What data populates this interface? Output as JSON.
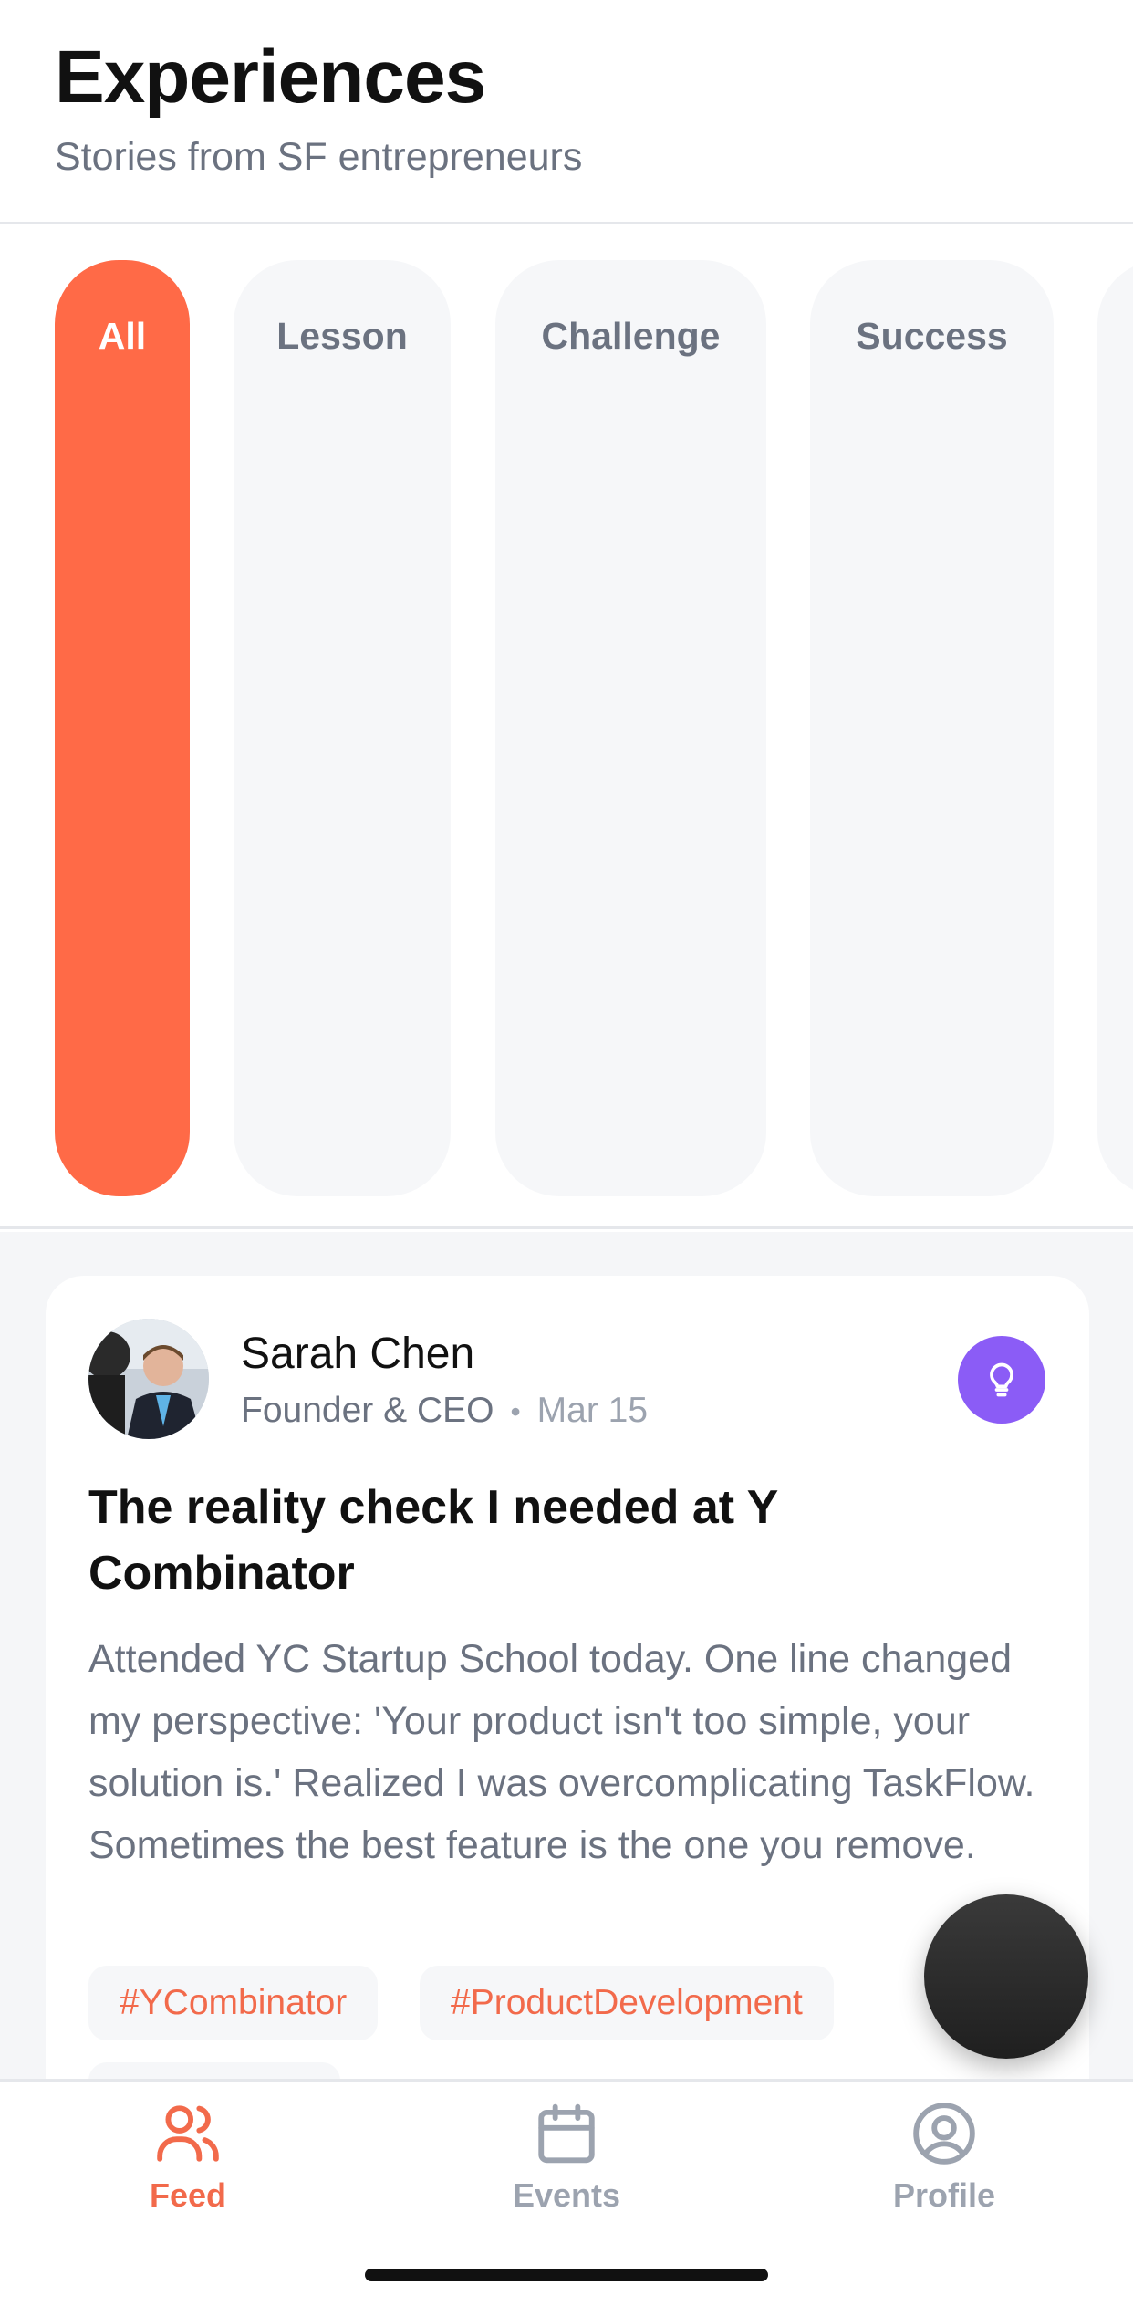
{
  "header": {
    "title": "Experiences",
    "subtitle": "Stories from SF entrepreneurs"
  },
  "filters": [
    {
      "label": "All",
      "active": true
    },
    {
      "label": "Lesson",
      "active": false
    },
    {
      "label": "Challenge",
      "active": false
    },
    {
      "label": "Success",
      "active": false
    }
  ],
  "post": {
    "author": "Sarah Chen",
    "role": "Founder & CEO",
    "date": "Mar 15",
    "type_icon": "lightbulb-icon",
    "title": "The reality check I needed at Y Combinator",
    "body": "Attended YC Startup School today. One line changed my perspective: 'Your product isn't too simple, your solution is.' Realized I was overcomplicating TaskFlow. Sometimes the best feature is the one you remove.",
    "tags": [
      "#YCombinator",
      "#ProductDevelopment"
    ]
  },
  "fab": {
    "icon": "compose-icon"
  },
  "tabs": [
    {
      "label": "Feed",
      "icon": "people-icon",
      "active": true
    },
    {
      "label": "Events",
      "icon": "calendar-icon",
      "active": false
    },
    {
      "label": "Profile",
      "icon": "user-circle-icon",
      "active": false
    }
  ],
  "colors": {
    "accent": "#ff6a47",
    "tag_text": "#f26a4b",
    "badge_purple": "#8b5cf6",
    "muted_text": "#6b7280",
    "chip_bg": "#f6f7f9"
  }
}
